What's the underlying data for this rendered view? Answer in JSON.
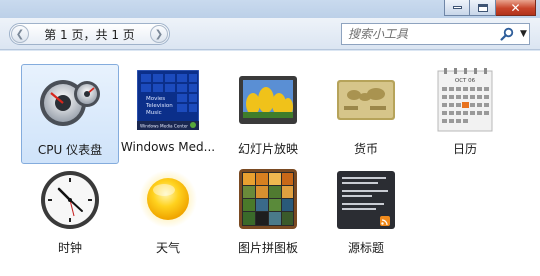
{
  "window": {
    "controls": [
      "minimize-icon",
      "maximize-icon",
      "close-icon"
    ],
    "close_glyph": "✕"
  },
  "toolbar": {
    "prev_glyph": "❮",
    "next_glyph": "❯",
    "page_text": "第 1 页，共 1 页",
    "search_placeholder": "搜索小工具",
    "search_dropdown_glyph": "▼"
  },
  "gadgets": [
    {
      "label": "CPU 仪表盘",
      "icon": "cpu-meter-icon",
      "selected": true
    },
    {
      "label": "Windows Med...",
      "icon": "windows-media-center-icon",
      "selected": false
    },
    {
      "label": "幻灯片放映",
      "icon": "slideshow-icon",
      "selected": false
    },
    {
      "label": "货币",
      "icon": "currency-icon",
      "selected": false
    },
    {
      "label": "日历",
      "icon": "calendar-icon",
      "selected": false
    },
    {
      "label": "时钟",
      "icon": "clock-icon",
      "selected": false
    },
    {
      "label": "天气",
      "icon": "weather-icon",
      "selected": false
    },
    {
      "label": "图片拼图板",
      "icon": "picture-puzzle-icon",
      "selected": false
    },
    {
      "label": "源标题",
      "icon": "feed-headlines-icon",
      "selected": false
    }
  ],
  "thumb_text": {
    "wmc_menu": [
      "Movies",
      "Television",
      "Music"
    ],
    "wmc_bar": "Windows Media Center",
    "calendar_month": "OCT 06"
  },
  "colors": {
    "selection": "#cfe3fa",
    "selection_border": "#84acdd",
    "toolbar": "#dbe5f2",
    "close_button": "#c8452b"
  }
}
